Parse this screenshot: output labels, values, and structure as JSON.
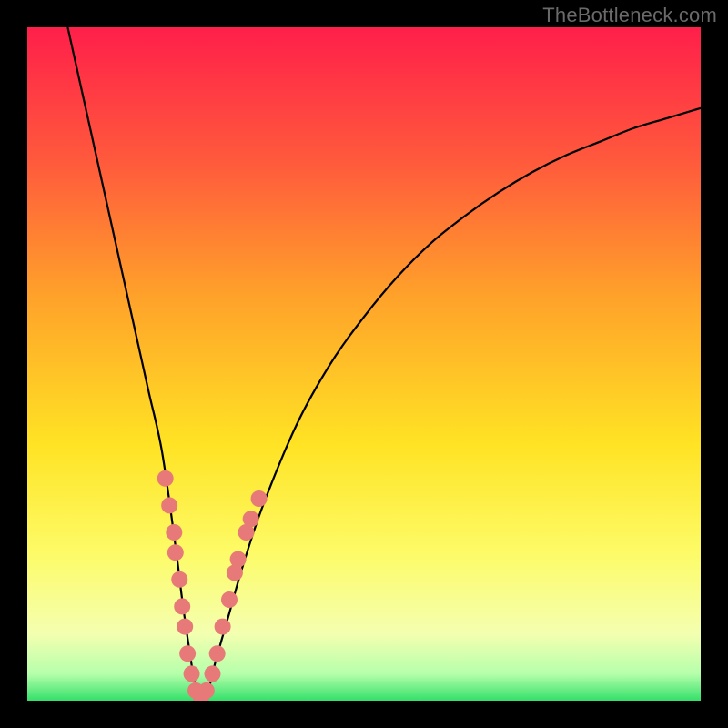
{
  "watermark": "TheBottleneck.com",
  "chart_data": {
    "type": "line",
    "title": "",
    "xlabel": "",
    "ylabel": "",
    "xlim": [
      0,
      100
    ],
    "ylim": [
      0,
      100
    ],
    "gradient_stops": [
      {
        "pct": 0,
        "color": "#ff1f4a"
      },
      {
        "pct": 20,
        "color": "#ff5a3c"
      },
      {
        "pct": 40,
        "color": "#ffa22a"
      },
      {
        "pct": 62,
        "color": "#ffe324"
      },
      {
        "pct": 78,
        "color": "#fdfb67"
      },
      {
        "pct": 90,
        "color": "#f4ffb0"
      },
      {
        "pct": 96,
        "color": "#b6ffab"
      },
      {
        "pct": 100,
        "color": "#34e06a"
      }
    ],
    "series": [
      {
        "name": "bottleneck-curve",
        "x": [
          6,
          8,
          10,
          12,
          14,
          16,
          18,
          20,
          22,
          23,
          24,
          25,
          26,
          27,
          28,
          30,
          32,
          35,
          40,
          45,
          50,
          55,
          60,
          65,
          70,
          75,
          80,
          85,
          90,
          95,
          100
        ],
        "y": [
          100,
          91,
          82,
          73,
          64,
          55,
          46,
          37,
          23,
          15,
          8,
          2,
          0,
          2,
          6,
          13,
          20,
          29,
          41,
          50,
          57,
          63,
          68,
          72,
          75.5,
          78.5,
          81,
          83,
          85,
          86.5,
          88
        ]
      }
    ],
    "scatter": {
      "name": "highlight-points",
      "color": "#e77a78",
      "points": [
        {
          "x": 20.5,
          "y": 33
        },
        {
          "x": 21.1,
          "y": 29
        },
        {
          "x": 21.8,
          "y": 25
        },
        {
          "x": 22.0,
          "y": 22
        },
        {
          "x": 22.6,
          "y": 18
        },
        {
          "x": 23.0,
          "y": 14
        },
        {
          "x": 23.4,
          "y": 11
        },
        {
          "x": 23.8,
          "y": 7
        },
        {
          "x": 24.4,
          "y": 4
        },
        {
          "x": 25.0,
          "y": 1.5
        },
        {
          "x": 25.8,
          "y": 0.5
        },
        {
          "x": 26.6,
          "y": 1.5
        },
        {
          "x": 27.5,
          "y": 4
        },
        {
          "x": 28.2,
          "y": 7
        },
        {
          "x": 29.0,
          "y": 11
        },
        {
          "x": 30.0,
          "y": 15
        },
        {
          "x": 30.8,
          "y": 19
        },
        {
          "x": 31.3,
          "y": 21
        },
        {
          "x": 32.5,
          "y": 25
        },
        {
          "x": 33.2,
          "y": 27
        },
        {
          "x": 34.4,
          "y": 30
        }
      ]
    }
  }
}
